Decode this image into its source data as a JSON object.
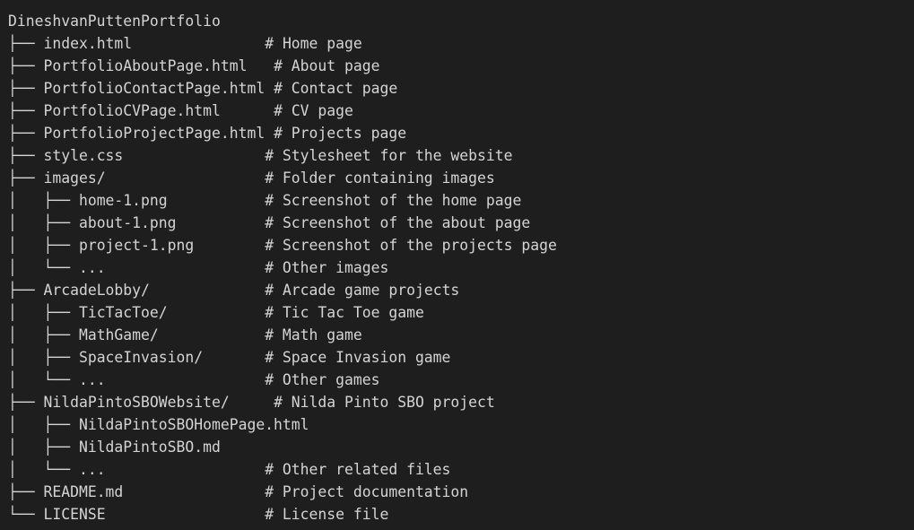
{
  "root": "DineshvanPuttenPortfolio",
  "lines": [
    {
      "prefix": "├── ",
      "name": "index.html",
      "pad": "               ",
      "comment": "# Home page"
    },
    {
      "prefix": "├── ",
      "name": "PortfolioAboutPage.html",
      "pad": "   ",
      "comment": "# About page"
    },
    {
      "prefix": "├── ",
      "name": "PortfolioContactPage.html",
      "pad": " ",
      "comment": "# Contact page"
    },
    {
      "prefix": "├── ",
      "name": "PortfolioCVPage.html",
      "pad": "      ",
      "comment": "# CV page"
    },
    {
      "prefix": "├── ",
      "name": "PortfolioProjectPage.html",
      "pad": " ",
      "comment": "# Projects page"
    },
    {
      "prefix": "├── ",
      "name": "style.css",
      "pad": "                ",
      "comment": "# Stylesheet for the website"
    },
    {
      "prefix": "├── ",
      "name": "images/",
      "pad": "                  ",
      "comment": "# Folder containing images"
    },
    {
      "prefix": "│   ├── ",
      "name": "home-1.png",
      "pad": "           ",
      "comment": "# Screenshot of the home page"
    },
    {
      "prefix": "│   ├── ",
      "name": "about-1.png",
      "pad": "          ",
      "comment": "# Screenshot of the about page"
    },
    {
      "prefix": "│   ├── ",
      "name": "project-1.png",
      "pad": "        ",
      "comment": "# Screenshot of the projects page"
    },
    {
      "prefix": "│   └── ",
      "name": "...",
      "pad": "                  ",
      "comment": "# Other images"
    },
    {
      "prefix": "├── ",
      "name": "ArcadeLobby/",
      "pad": "             ",
      "comment": "# Arcade game projects"
    },
    {
      "prefix": "│   ├── ",
      "name": "TicTacToe/",
      "pad": "           ",
      "comment": "# Tic Tac Toe game"
    },
    {
      "prefix": "│   ├── ",
      "name": "MathGame/",
      "pad": "            ",
      "comment": "# Math game"
    },
    {
      "prefix": "│   ├── ",
      "name": "SpaceInvasion/",
      "pad": "       ",
      "comment": "# Space Invasion game"
    },
    {
      "prefix": "│   └── ",
      "name": "...",
      "pad": "                  ",
      "comment": "# Other games"
    },
    {
      "prefix": "├── ",
      "name": "NildaPintoSBOWebsite/",
      "pad": "     ",
      "comment": "# Nilda Pinto SBO project"
    },
    {
      "prefix": "│   ├── ",
      "name": "NildaPintoSBOHomePage.html",
      "pad": "",
      "comment": ""
    },
    {
      "prefix": "│   ├── ",
      "name": "NildaPintoSBO.md",
      "pad": "",
      "comment": ""
    },
    {
      "prefix": "│   └── ",
      "name": "...",
      "pad": "                  ",
      "comment": "# Other related files"
    },
    {
      "prefix": "├── ",
      "name": "README.md",
      "pad": "                ",
      "comment": "# Project documentation"
    },
    {
      "prefix": "└── ",
      "name": "LICENSE",
      "pad": "                  ",
      "comment": "# License file"
    }
  ]
}
